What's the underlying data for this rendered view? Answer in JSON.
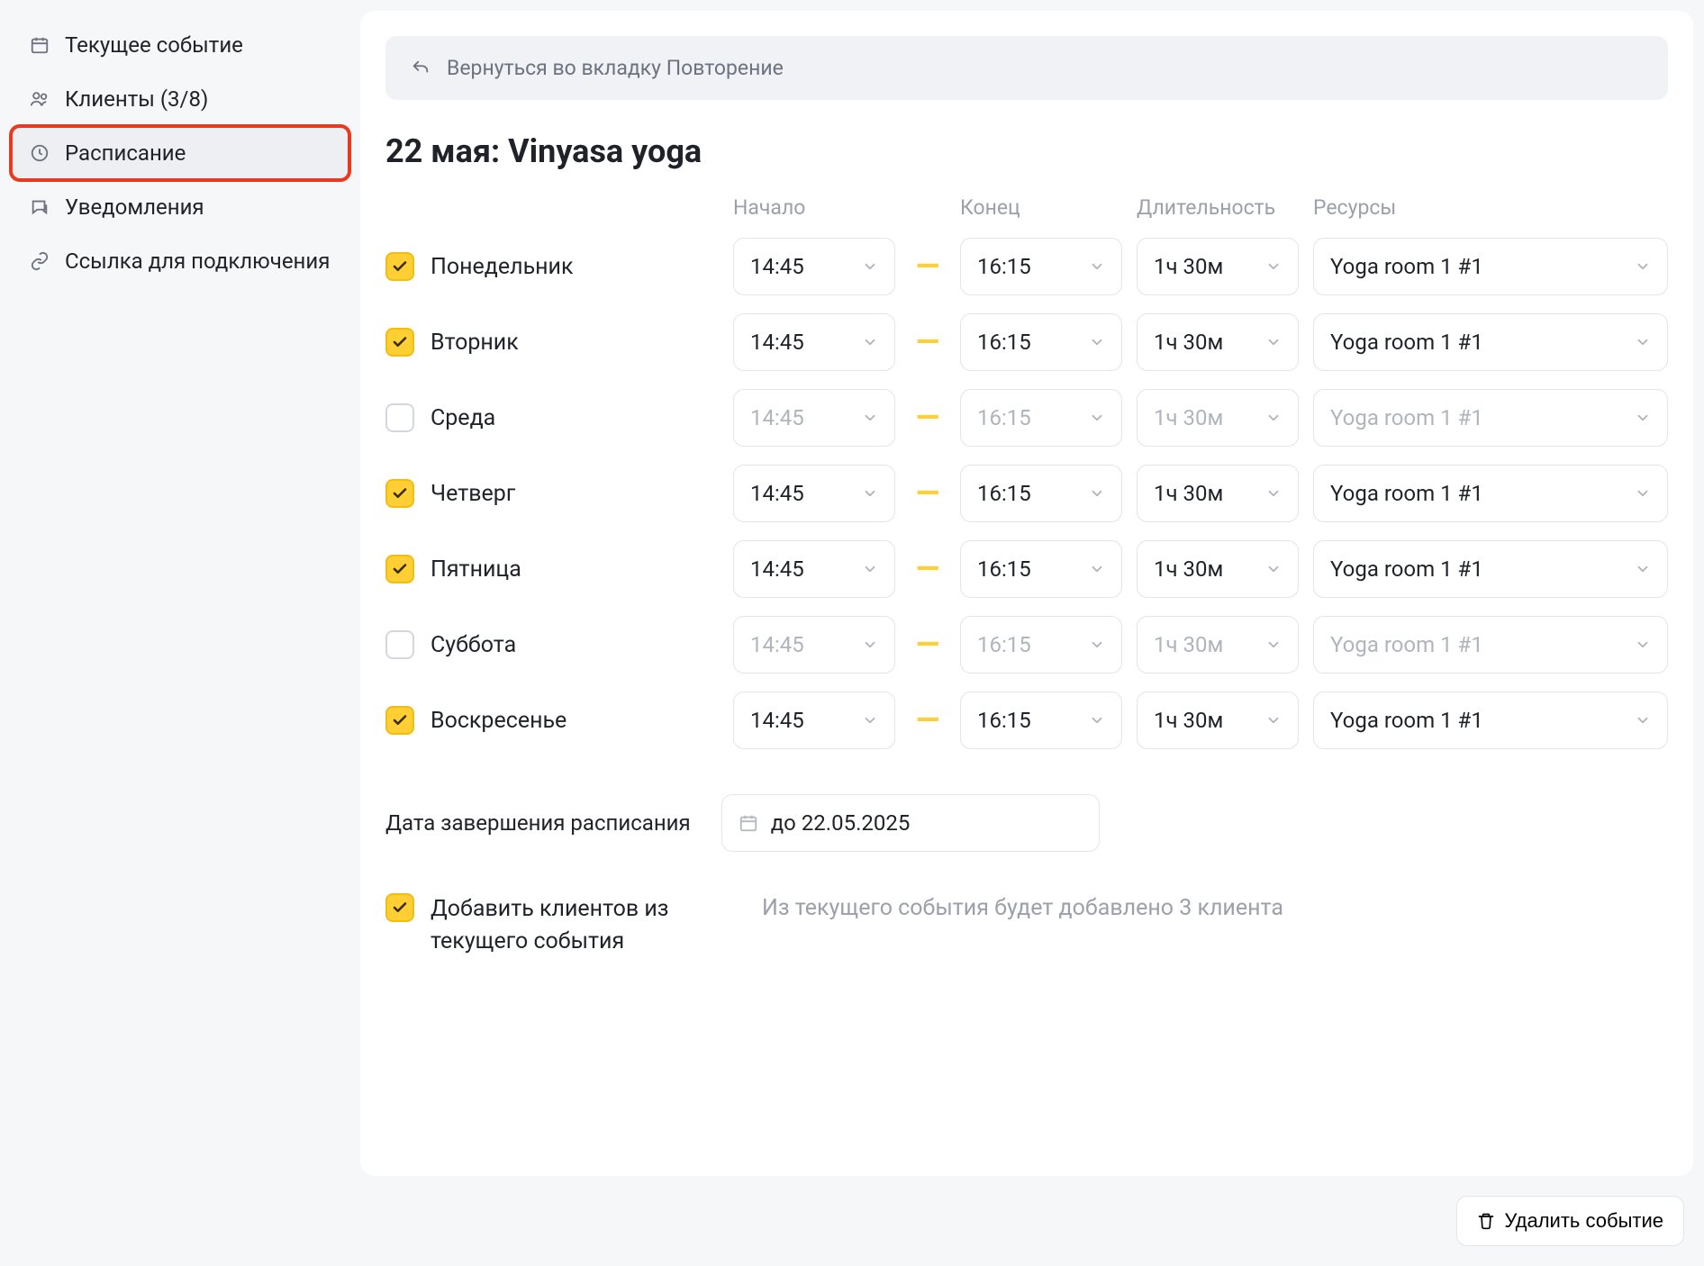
{
  "sidebar": {
    "items": [
      {
        "icon": "calendar",
        "label": "Текущее событие"
      },
      {
        "icon": "users",
        "label": "Клиенты (3/8)"
      },
      {
        "icon": "clock",
        "label": "Расписание"
      },
      {
        "icon": "chat",
        "label": "Уведомления"
      },
      {
        "icon": "link",
        "label": "Ссылка для подключения"
      }
    ],
    "activeIndex": 2,
    "highlightedIndex": 2
  },
  "backBar": {
    "label": "Вернуться во вкладку Повторение"
  },
  "pageTitle": "22 мая: Vinyasa yoga",
  "headers": {
    "start": "Начало",
    "end": "Конец",
    "duration": "Длительность",
    "resources": "Ресурсы"
  },
  "days": [
    {
      "checked": true,
      "label": "Понедельник",
      "start": "14:45",
      "end": "16:15",
      "duration": "1ч 30м",
      "resource": "Yoga room 1 #1"
    },
    {
      "checked": true,
      "label": "Вторник",
      "start": "14:45",
      "end": "16:15",
      "duration": "1ч 30м",
      "resource": "Yoga room 1 #1"
    },
    {
      "checked": false,
      "label": "Среда",
      "start": "14:45",
      "end": "16:15",
      "duration": "1ч 30м",
      "resource": "Yoga room 1 #1"
    },
    {
      "checked": true,
      "label": "Четверг",
      "start": "14:45",
      "end": "16:15",
      "duration": "1ч 30м",
      "resource": "Yoga room 1 #1"
    },
    {
      "checked": true,
      "label": "Пятница",
      "start": "14:45",
      "end": "16:15",
      "duration": "1ч 30м",
      "resource": "Yoga room 1 #1"
    },
    {
      "checked": false,
      "label": "Суббота",
      "start": "14:45",
      "end": "16:15",
      "duration": "1ч 30м",
      "resource": "Yoga room 1 #1"
    },
    {
      "checked": true,
      "label": "Воскресенье",
      "start": "14:45",
      "end": "16:15",
      "duration": "1ч 30м",
      "resource": "Yoga room 1 #1"
    }
  ],
  "endDate": {
    "label": "Дата завершения расписания",
    "value": "до 22.05.2025"
  },
  "addClients": {
    "checked": true,
    "label": "Добавить клиентов из текущего события",
    "desc": "Из текущего события будет добавлено 3 клиента"
  },
  "deleteBtn": {
    "label": "Удалить событие"
  },
  "dash": "—"
}
